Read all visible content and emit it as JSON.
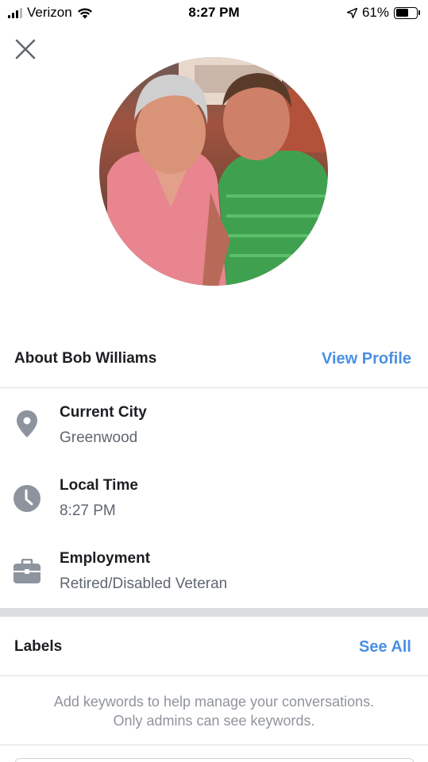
{
  "status_bar": {
    "carrier": "Verizon",
    "time": "8:27 PM",
    "battery_percent": "61%",
    "battery_level": 0.61,
    "signal_bars_filled": 3,
    "signal_bars_total": 4
  },
  "profile": {
    "about_title": "About Bob Williams",
    "view_profile_label": "View Profile"
  },
  "info": {
    "city": {
      "label": "Current City",
      "value": "Greenwood",
      "icon": "location-pin-icon"
    },
    "local_time": {
      "label": "Local Time",
      "value": "8:27 PM",
      "icon": "clock-icon"
    },
    "employment": {
      "label": "Employment",
      "value": "Retired/Disabled Veteran",
      "icon": "briefcase-icon"
    }
  },
  "labels_section": {
    "title": "Labels",
    "see_all_label": "See All",
    "hint_line1": "Add keywords to help manage your conversations.",
    "hint_line2": "Only admins can see keywords."
  },
  "colors": {
    "link": "#4a90e2",
    "icon_gray": "#8d949e",
    "secondary_text": "#606770",
    "hint_text": "#90949c"
  }
}
